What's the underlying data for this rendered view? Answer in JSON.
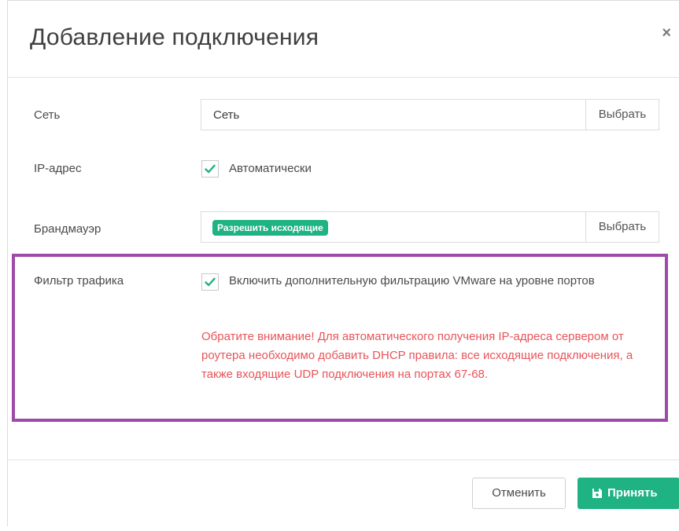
{
  "dialog": {
    "title": "Добавление подключения",
    "close_symbol": "×"
  },
  "network": {
    "label": "Сеть",
    "value": "Сеть",
    "select_label": "Выбрать"
  },
  "ip_address": {
    "label": "IP-адрес",
    "checkbox_checked": true,
    "checkbox_label": "Автоматически"
  },
  "firewall": {
    "label": "Брандмауэр",
    "tag": "Разрешить исходящие",
    "select_label": "Выбрать"
  },
  "traffic_filter": {
    "label": "Фильтр трафика",
    "checkbox_checked": true,
    "checkbox_label": "Включить дополнительную фильтрацию VMware на уровне портов",
    "warning": "Обратите внимание! Для автоматического получения IP-адреса сервером от роутера необходимо добавить DHCP правила:  все исходящие подключения, а также входящие UDP подключения на портах 67-68."
  },
  "footer": {
    "cancel_label": "Отменить",
    "accept_label": "Принять",
    "accept_icon": "save-icon"
  },
  "colors": {
    "accent": "#1fb283",
    "warning": "#e8545a",
    "highlight_border": "#9d4aa8"
  }
}
